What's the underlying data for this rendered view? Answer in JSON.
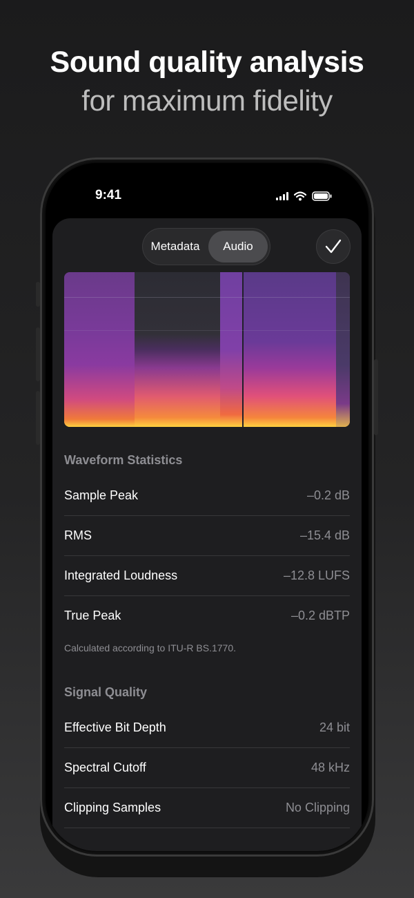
{
  "header": {
    "title": "Sound quality analysis",
    "subtitle": "for maximum fidelity"
  },
  "status_bar": {
    "time": "9:41",
    "icons": [
      "signal-icon",
      "wifi-icon",
      "battery-icon"
    ]
  },
  "segmented_control": {
    "options": [
      {
        "label": "Metadata",
        "selected": false
      },
      {
        "label": "Audio",
        "selected": true
      }
    ]
  },
  "done_button": {
    "icon": "checkmark-icon"
  },
  "waveform_statistics": {
    "title": "Waveform Statistics",
    "rows": [
      {
        "label": "Sample Peak",
        "value": "–0.2 dB"
      },
      {
        "label": "RMS",
        "value": "–15.4 dB"
      },
      {
        "label": "Integrated Loudness",
        "value": "–12.8 LUFS"
      },
      {
        "label": "True Peak",
        "value": "–0.2 dBTP"
      }
    ],
    "footnote": "Calculated according to ITU-R BS.1770."
  },
  "signal_quality": {
    "title": "Signal Quality",
    "rows": [
      {
        "label": "Effective Bit Depth",
        "value": "24 bit"
      },
      {
        "label": "Spectral Cutoff",
        "value": "48 kHz"
      },
      {
        "label": "Clipping Samples",
        "value": "No Clipping"
      }
    ]
  },
  "colors": {
    "background": "#1b1b1c",
    "sheet": "#1e1e20",
    "secondary_text": "#8e8e93",
    "separator": "#38383a",
    "spectrogram_low": "#4a2a5a",
    "spectrogram_high": "#ffd040"
  }
}
